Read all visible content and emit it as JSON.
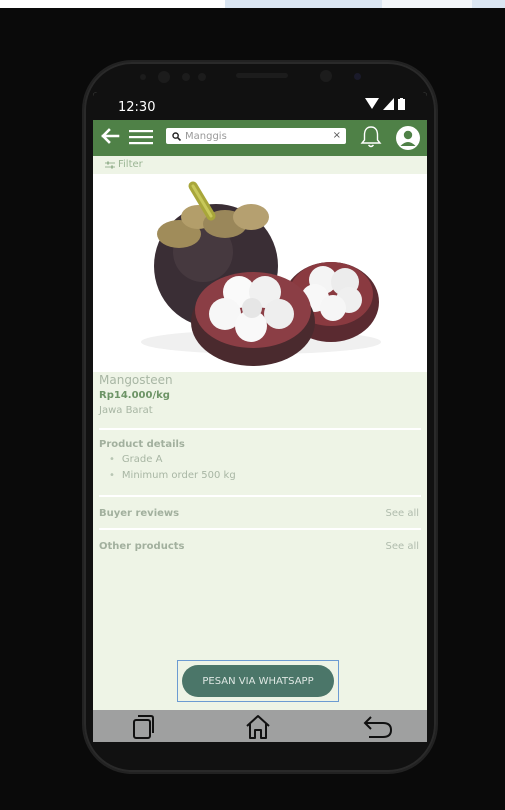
{
  "status_bar": {
    "time": "12:30"
  },
  "app_bar": {
    "search_value": "Manggis",
    "clear_label": "×"
  },
  "filter": {
    "label": "Filter"
  },
  "product": {
    "name": "Mangosteen",
    "price": "Rp14.000/kg",
    "region": "Jawa Barat"
  },
  "details": {
    "title": "Product details",
    "items": [
      "Grade A",
      "Minimum order 500 kg"
    ]
  },
  "reviews": {
    "title": "Buyer reviews",
    "see_all": "See all"
  },
  "other_products": {
    "title": "Other products",
    "see_all": "See all"
  },
  "cta": {
    "label": "PESAN VIA WHATSAPP"
  },
  "colors": {
    "app_bar": "#4f8147",
    "screen_bg": "#eef4e6",
    "cta_bg": "#4b7669",
    "nav_bar": "#9fa0a0"
  },
  "icons": {
    "back": "back-arrow-icon",
    "menu": "hamburger-menu-icon",
    "search": "search-icon",
    "bell": "bell-icon",
    "user": "user-avatar-icon",
    "filter": "filter-icon",
    "nav_recent": "recent-apps-icon",
    "nav_home": "home-icon",
    "nav_back": "back-icon"
  }
}
